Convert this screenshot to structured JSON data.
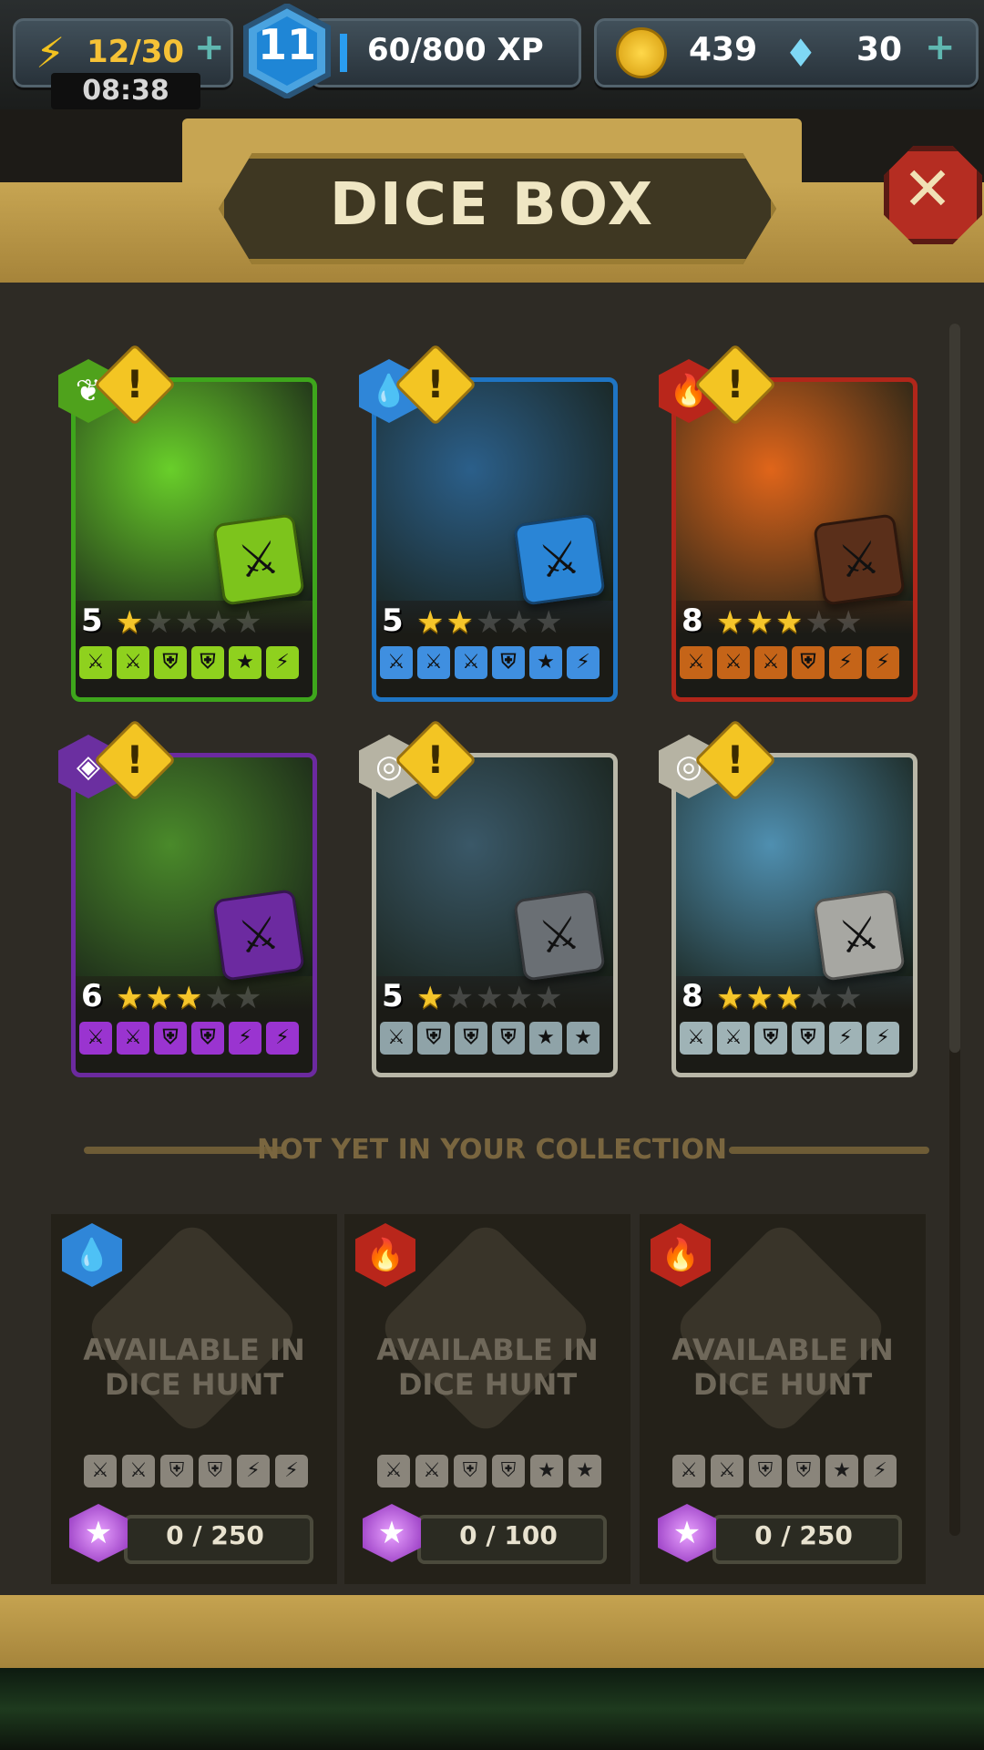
{
  "hud": {
    "energy": "12/30",
    "timer": "08:38",
    "level": "11",
    "xp": "60/800 XP",
    "coins": "439",
    "gems": "30",
    "plus": "+"
  },
  "title": "DICE BOX",
  "divider": "NOT YET IN YOUR COLLECTION",
  "owned": [
    {
      "element": "nature",
      "level": "5",
      "stars": 1,
      "color": "#3ea61c",
      "bg": "#69cf2a",
      "dice": "#7dc41c",
      "faces": [
        "sword",
        "sword",
        "shield",
        "shield",
        "star",
        "bolt"
      ],
      "faceColor": "#8fd11e"
    },
    {
      "element": "water",
      "level": "5",
      "stars": 2,
      "color": "#1f75c4",
      "bg": "#2b5f8a",
      "dice": "#2a85d6",
      "faces": [
        "sword",
        "sword",
        "sword",
        "shield",
        "star",
        "bolt"
      ],
      "faceColor": "#3f8fe0"
    },
    {
      "element": "fire",
      "level": "8",
      "stars": 3,
      "color": "#b1261a",
      "bg": "#e0651a",
      "dice": "#5a2f1a",
      "faces": [
        "sword",
        "sword",
        "sword",
        "shield",
        "bolt",
        "bolt"
      ],
      "faceColor": "#c56418"
    },
    {
      "element": "arcane",
      "level": "6",
      "stars": 3,
      "color": "#6c2aa0",
      "bg": "#4a8a2a",
      "dice": "#6c2aa0",
      "faces": [
        "sword",
        "sword",
        "shield",
        "shield",
        "bolt",
        "bolt"
      ],
      "faceColor": "#9a34d0"
    },
    {
      "element": "neutral",
      "level": "5",
      "stars": 1,
      "color": "#b9b7a8",
      "bg": "#3a5868",
      "dice": "#6a6f74",
      "faces": [
        "sword",
        "shield",
        "shield",
        "shield",
        "star",
        "star"
      ],
      "faceColor": "#8fa3a8"
    },
    {
      "element": "neutral",
      "level": "8",
      "stars": 3,
      "color": "#b9b7a8",
      "bg": "#4f8fb0",
      "dice": "#a7a7a2",
      "faces": [
        "sword",
        "sword",
        "shield",
        "shield",
        "bolt",
        "bolt"
      ],
      "faceColor": "#9fb3b6"
    }
  ],
  "locked": [
    {
      "element": "water",
      "label": "AVAILABLE IN\nDICE HUNT",
      "shards": "0 / 250",
      "faces": [
        "sword",
        "sword",
        "shield",
        "shield",
        "bolt",
        "bolt"
      ]
    },
    {
      "element": "fire",
      "label": "AVAILABLE IN\nDICE HUNT",
      "shards": "0 / 100",
      "faces": [
        "sword",
        "sword",
        "shield",
        "shield",
        "star",
        "star"
      ]
    },
    {
      "element": "fire",
      "label": "AVAILABLE IN\nDICE HUNT",
      "shards": "0 / 250",
      "faces": [
        "sword",
        "sword",
        "shield",
        "shield",
        "star",
        "bolt"
      ]
    }
  ],
  "colors": {
    "water": "#2f86d8",
    "fire": "#b9261b",
    "nature": "#4fa21c",
    "arcane": "#6b2fa0",
    "neutral": "#b6b3a3"
  },
  "icons": {
    "sword": "⚔",
    "shield": "⛨",
    "star": "★",
    "bolt": "⚡",
    "nature": "❦",
    "water": "💧",
    "fire": "🔥",
    "arcane": "◈",
    "neutral": "◎"
  }
}
